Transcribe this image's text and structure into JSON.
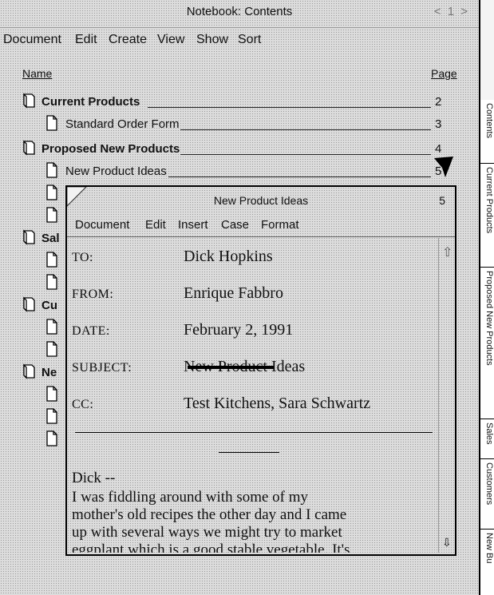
{
  "window": {
    "title": "Notebook: Contents",
    "page_indicator": "< 1 >",
    "menu": [
      "Document",
      "Edit",
      "Create",
      "View",
      "Show",
      "Sort"
    ]
  },
  "list": {
    "headers": {
      "name": "Name",
      "page": "Page"
    },
    "rows": [
      {
        "label": "Current Products",
        "page": "2",
        "kind": "notebook",
        "bold": true
      },
      {
        "label": "Standard Order Form",
        "page": "3",
        "kind": "page",
        "bold": false
      },
      {
        "label": "Proposed New Products",
        "page": "4",
        "kind": "notebook",
        "bold": true
      },
      {
        "label": "New Product Ideas",
        "page": "5",
        "kind": "page",
        "bold": false
      },
      {
        "label": "",
        "page": "",
        "kind": "page",
        "bold": false
      },
      {
        "label": "",
        "page": "",
        "kind": "page",
        "bold": false
      },
      {
        "label": "Sal",
        "page": "",
        "kind": "notebook",
        "bold": true
      },
      {
        "label": "",
        "page": "",
        "kind": "page",
        "bold": false
      },
      {
        "label": "",
        "page": "",
        "kind": "page",
        "bold": false
      },
      {
        "label": "Cu",
        "page": "",
        "kind": "notebook",
        "bold": true
      },
      {
        "label": "",
        "page": "",
        "kind": "page",
        "bold": false
      },
      {
        "label": "",
        "page": "",
        "kind": "page",
        "bold": false
      },
      {
        "label": "Ne",
        "page": "",
        "kind": "notebook",
        "bold": true
      },
      {
        "label": "",
        "page": "",
        "kind": "page",
        "bold": false
      },
      {
        "label": "",
        "page": "",
        "kind": "page",
        "bold": false
      },
      {
        "label": "",
        "page": "",
        "kind": "page",
        "bold": false
      }
    ]
  },
  "side_tabs": [
    "Contents",
    "Current Products",
    "Proposed New Products",
    "Sales",
    "Customers",
    "New Bu"
  ],
  "memo": {
    "title": "New Product Ideas",
    "page": "5",
    "menu": [
      "Document",
      "Edit",
      "Insert",
      "Case",
      "Format"
    ],
    "fields": [
      {
        "name": "TO:",
        "value": "Dick Hopkins"
      },
      {
        "name": "FROM:",
        "value": "Enrique Fabbro"
      },
      {
        "name": "DATE:",
        "value": "February 2, 1991"
      },
      {
        "name": "SUBJECT:",
        "value": "New Product Ideas"
      },
      {
        "name": "CC:",
        "value": "Test Kitchens, Sara Schwartz"
      }
    ],
    "greeting": "Dick --",
    "body_lines": [
      "I was fiddling around with some of my",
      "mother's old recipes the other day and I came",
      "up with several ways we might try to market",
      "eggplant which is a good stable vegetable. It's"
    ]
  }
}
